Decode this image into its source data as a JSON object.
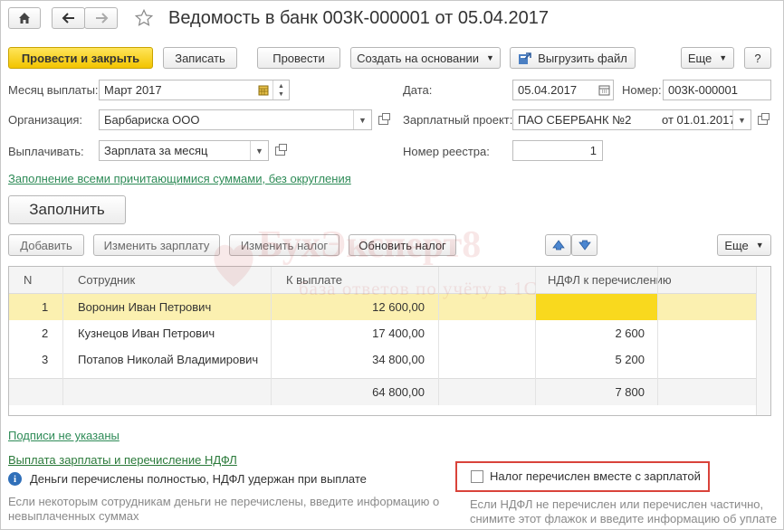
{
  "titlebar": {
    "title": "Ведомость в банк 003К-000001 от 05.04.2017",
    "home_icon": "home-icon",
    "back_icon": "arrow-left-icon",
    "forward_icon": "arrow-right-icon",
    "star_icon": "star-icon"
  },
  "toolbar": {
    "post_close": "Провести и закрыть",
    "save": "Записать",
    "post": "Провести",
    "create_based": "Создать на основании",
    "export_file": "Выгрузить файл",
    "more": "Еще",
    "help": "?"
  },
  "form": {
    "month_label": "Месяц выплаты:",
    "month_value": "Март 2017",
    "date_label": "Дата:",
    "date_value": "05.04.2017",
    "number_label": "Номер:",
    "number_value": "003К-000001",
    "org_label": "Организация:",
    "org_value": "Барбариска ООО",
    "project_label": "Зарплатный проект:",
    "project_value": "ПАО СБЕРБАНК №2",
    "project_date": "от 01.01.2017",
    "pay_label": "Выплачивать:",
    "pay_value": "Зарплата за месяц",
    "registry_label": "Номер реестра:",
    "registry_value": "1"
  },
  "fill_link": "Заполнение всеми причитающимися суммами, без округления",
  "fill_button": "Заполнить",
  "table_toolbar": {
    "add": "Добавить",
    "change_salary": "Изменить зарплату",
    "change_tax": "Изменить налог",
    "update_tax": "Обновить налог",
    "more": "Еще"
  },
  "table": {
    "headers": [
      "N",
      "Сотрудник",
      "К выплате",
      "НДФЛ к перечислению"
    ],
    "rows": [
      {
        "n": "1",
        "employee": "Воронин Иван Петрович",
        "pay": "12 600,00",
        "tax": ""
      },
      {
        "n": "2",
        "employee": "Кузнецов Иван Петрович",
        "pay": "17 400,00",
        "tax": "2 600"
      },
      {
        "n": "3",
        "employee": "Потапов Николай Владимирович",
        "pay": "34 800,00",
        "tax": "5 200"
      }
    ],
    "totals": {
      "pay": "64 800,00",
      "tax": "7 800"
    }
  },
  "signatures_link": "Подписи не указаны",
  "payment_link": "Выплата зарплаты и перечисление НДФЛ",
  "info_text": "Деньги перечислены  полностью, НДФЛ удержан при выплате",
  "info_hint": [
    "Если некоторым сотрудникам деньги не перечислены, введите информацию о",
    "невыплаченных суммах"
  ],
  "tax_checkbox_label": "Налог перечислен вместе с зарплатой",
  "tax_hint": [
    "Если НДФЛ не перечислен или перечислен частично,",
    "снимите этот флажок и введите информацию об уплате"
  ],
  "watermark": {
    "brand": "БухЭксперт8",
    "tagline": "база ответов по учёту в 1С"
  },
  "colors": {
    "primary_button": "#f5cd0a",
    "selected_row": "#fbf0b0",
    "active_cell": "#f9d91e",
    "link": "#2e8b57",
    "highlight_border": "#d9433a"
  }
}
